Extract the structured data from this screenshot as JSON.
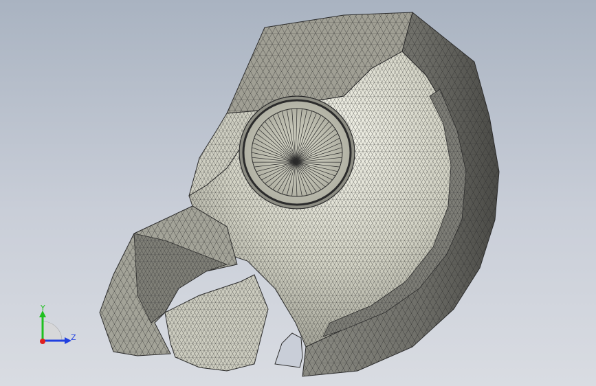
{
  "viewport": {
    "background_top": "#a9b3c1",
    "background_bottom": "#d9dce2"
  },
  "model": {
    "description_icon": "mesh-part-icon",
    "shade_dark": "#5b5b55",
    "shade_mid": "#9a9a90",
    "shade_light": "#e9e9dd",
    "edge_color": "#2b2b2b"
  },
  "triad": {
    "y_label": "Y",
    "z_label": "Z",
    "x_color": "#e02020",
    "y_color": "#20c020",
    "z_color": "#2040e0"
  }
}
